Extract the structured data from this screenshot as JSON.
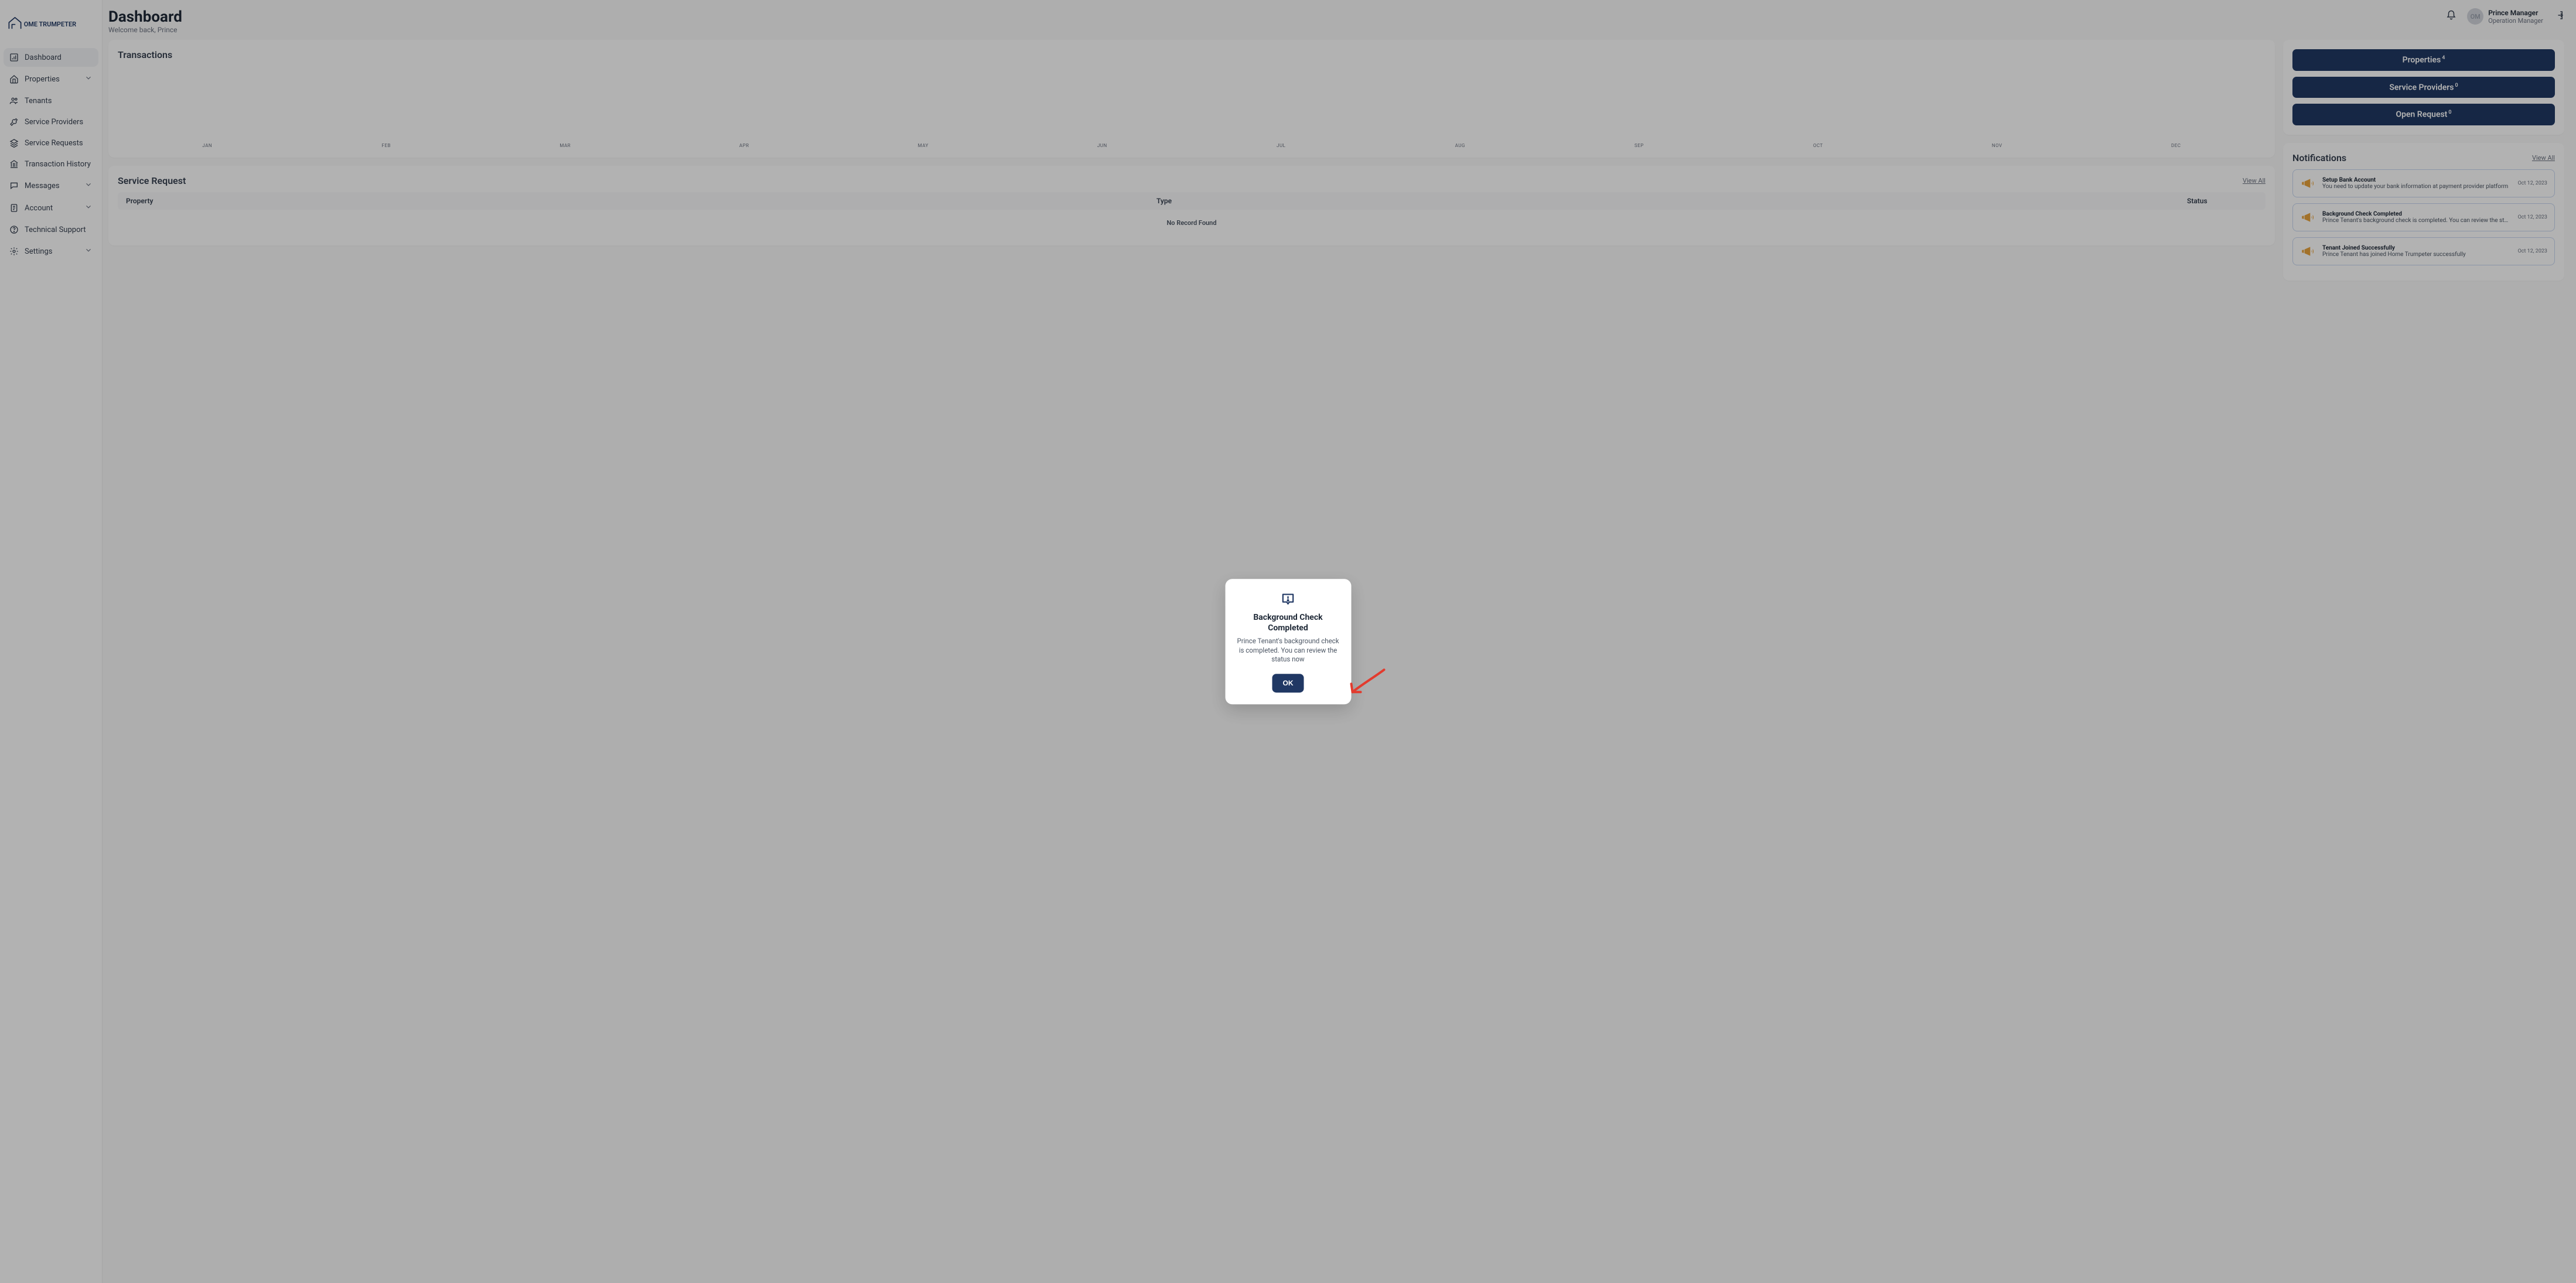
{
  "brand": {
    "name": "OME TRUMPETER"
  },
  "header": {
    "title": "Dashboard",
    "welcome": "Welcome back, Prince",
    "user_name": "Prince Manager",
    "user_role": "Operation Manager",
    "avatar_initials": "OM"
  },
  "sidebar": {
    "items": [
      {
        "label": "Dashboard",
        "active": true,
        "icon": "chart-bar-icon",
        "expandable": false
      },
      {
        "label": "Properties",
        "active": false,
        "icon": "home-icon",
        "expandable": true
      },
      {
        "label": "Tenants",
        "active": false,
        "icon": "users-icon",
        "expandable": false
      },
      {
        "label": "Service Providers",
        "active": false,
        "icon": "wrench-icon",
        "expandable": false
      },
      {
        "label": "Service Requests",
        "active": false,
        "icon": "layers-icon",
        "expandable": false
      },
      {
        "label": "Transaction History",
        "active": false,
        "icon": "bank-icon",
        "expandable": false
      },
      {
        "label": "Messages",
        "active": false,
        "icon": "chat-icon",
        "expandable": true
      },
      {
        "label": "Account",
        "active": false,
        "icon": "note-icon",
        "expandable": true
      },
      {
        "label": "Technical Support",
        "active": false,
        "icon": "help-icon",
        "expandable": false
      },
      {
        "label": "Settings",
        "active": false,
        "icon": "gear-icon",
        "expandable": true
      }
    ]
  },
  "transactions": {
    "title": "Transactions"
  },
  "chart_data": {
    "type": "bar",
    "categories": [
      "JAN",
      "FEB",
      "MAR",
      "APR",
      "MAY",
      "JUN",
      "JUL",
      "AUG",
      "SEP",
      "OCT",
      "NOV",
      "DEC"
    ],
    "values": [
      0,
      0,
      0,
      0,
      0,
      0,
      0,
      0,
      0,
      0,
      0,
      0
    ],
    "title": "Transactions",
    "xlabel": "",
    "ylabel": "",
    "ylim": [
      0,
      0
    ]
  },
  "service_request": {
    "title": "Service Request",
    "view_all": "View All",
    "columns": [
      "Property",
      "Type",
      "Status"
    ],
    "empty_label": "No Record Found",
    "rows": []
  },
  "summary": {
    "buttons": [
      {
        "label": "Properties",
        "count": "4"
      },
      {
        "label": "Service Providers",
        "count": "0"
      },
      {
        "label": "Open Request",
        "count": "0"
      }
    ]
  },
  "notifications": {
    "title": "Notifications",
    "view_all": "View All",
    "items": [
      {
        "title": "Setup Bank Account",
        "desc": "You need to update your bank information at payment provider platform",
        "date": "Oct 12, 2023"
      },
      {
        "title": "Background Check Completed",
        "desc": "Prince Tenant's background check is completed. You can review the status ...",
        "date": "Oct 12, 2023"
      },
      {
        "title": "Tenant Joined Successfully",
        "desc": "Prince Tenant has joined Home Trumpeter successfully",
        "date": "Oct 12, 2023"
      }
    ]
  },
  "modal": {
    "title": "Background Check Completed",
    "desc": "Prince Tenant's background check is completed. You can review the status now",
    "ok": "OK"
  },
  "colors": {
    "primary": "#203864",
    "accent_orange": "#e8a23b",
    "annot_red": "#e23b2e"
  }
}
